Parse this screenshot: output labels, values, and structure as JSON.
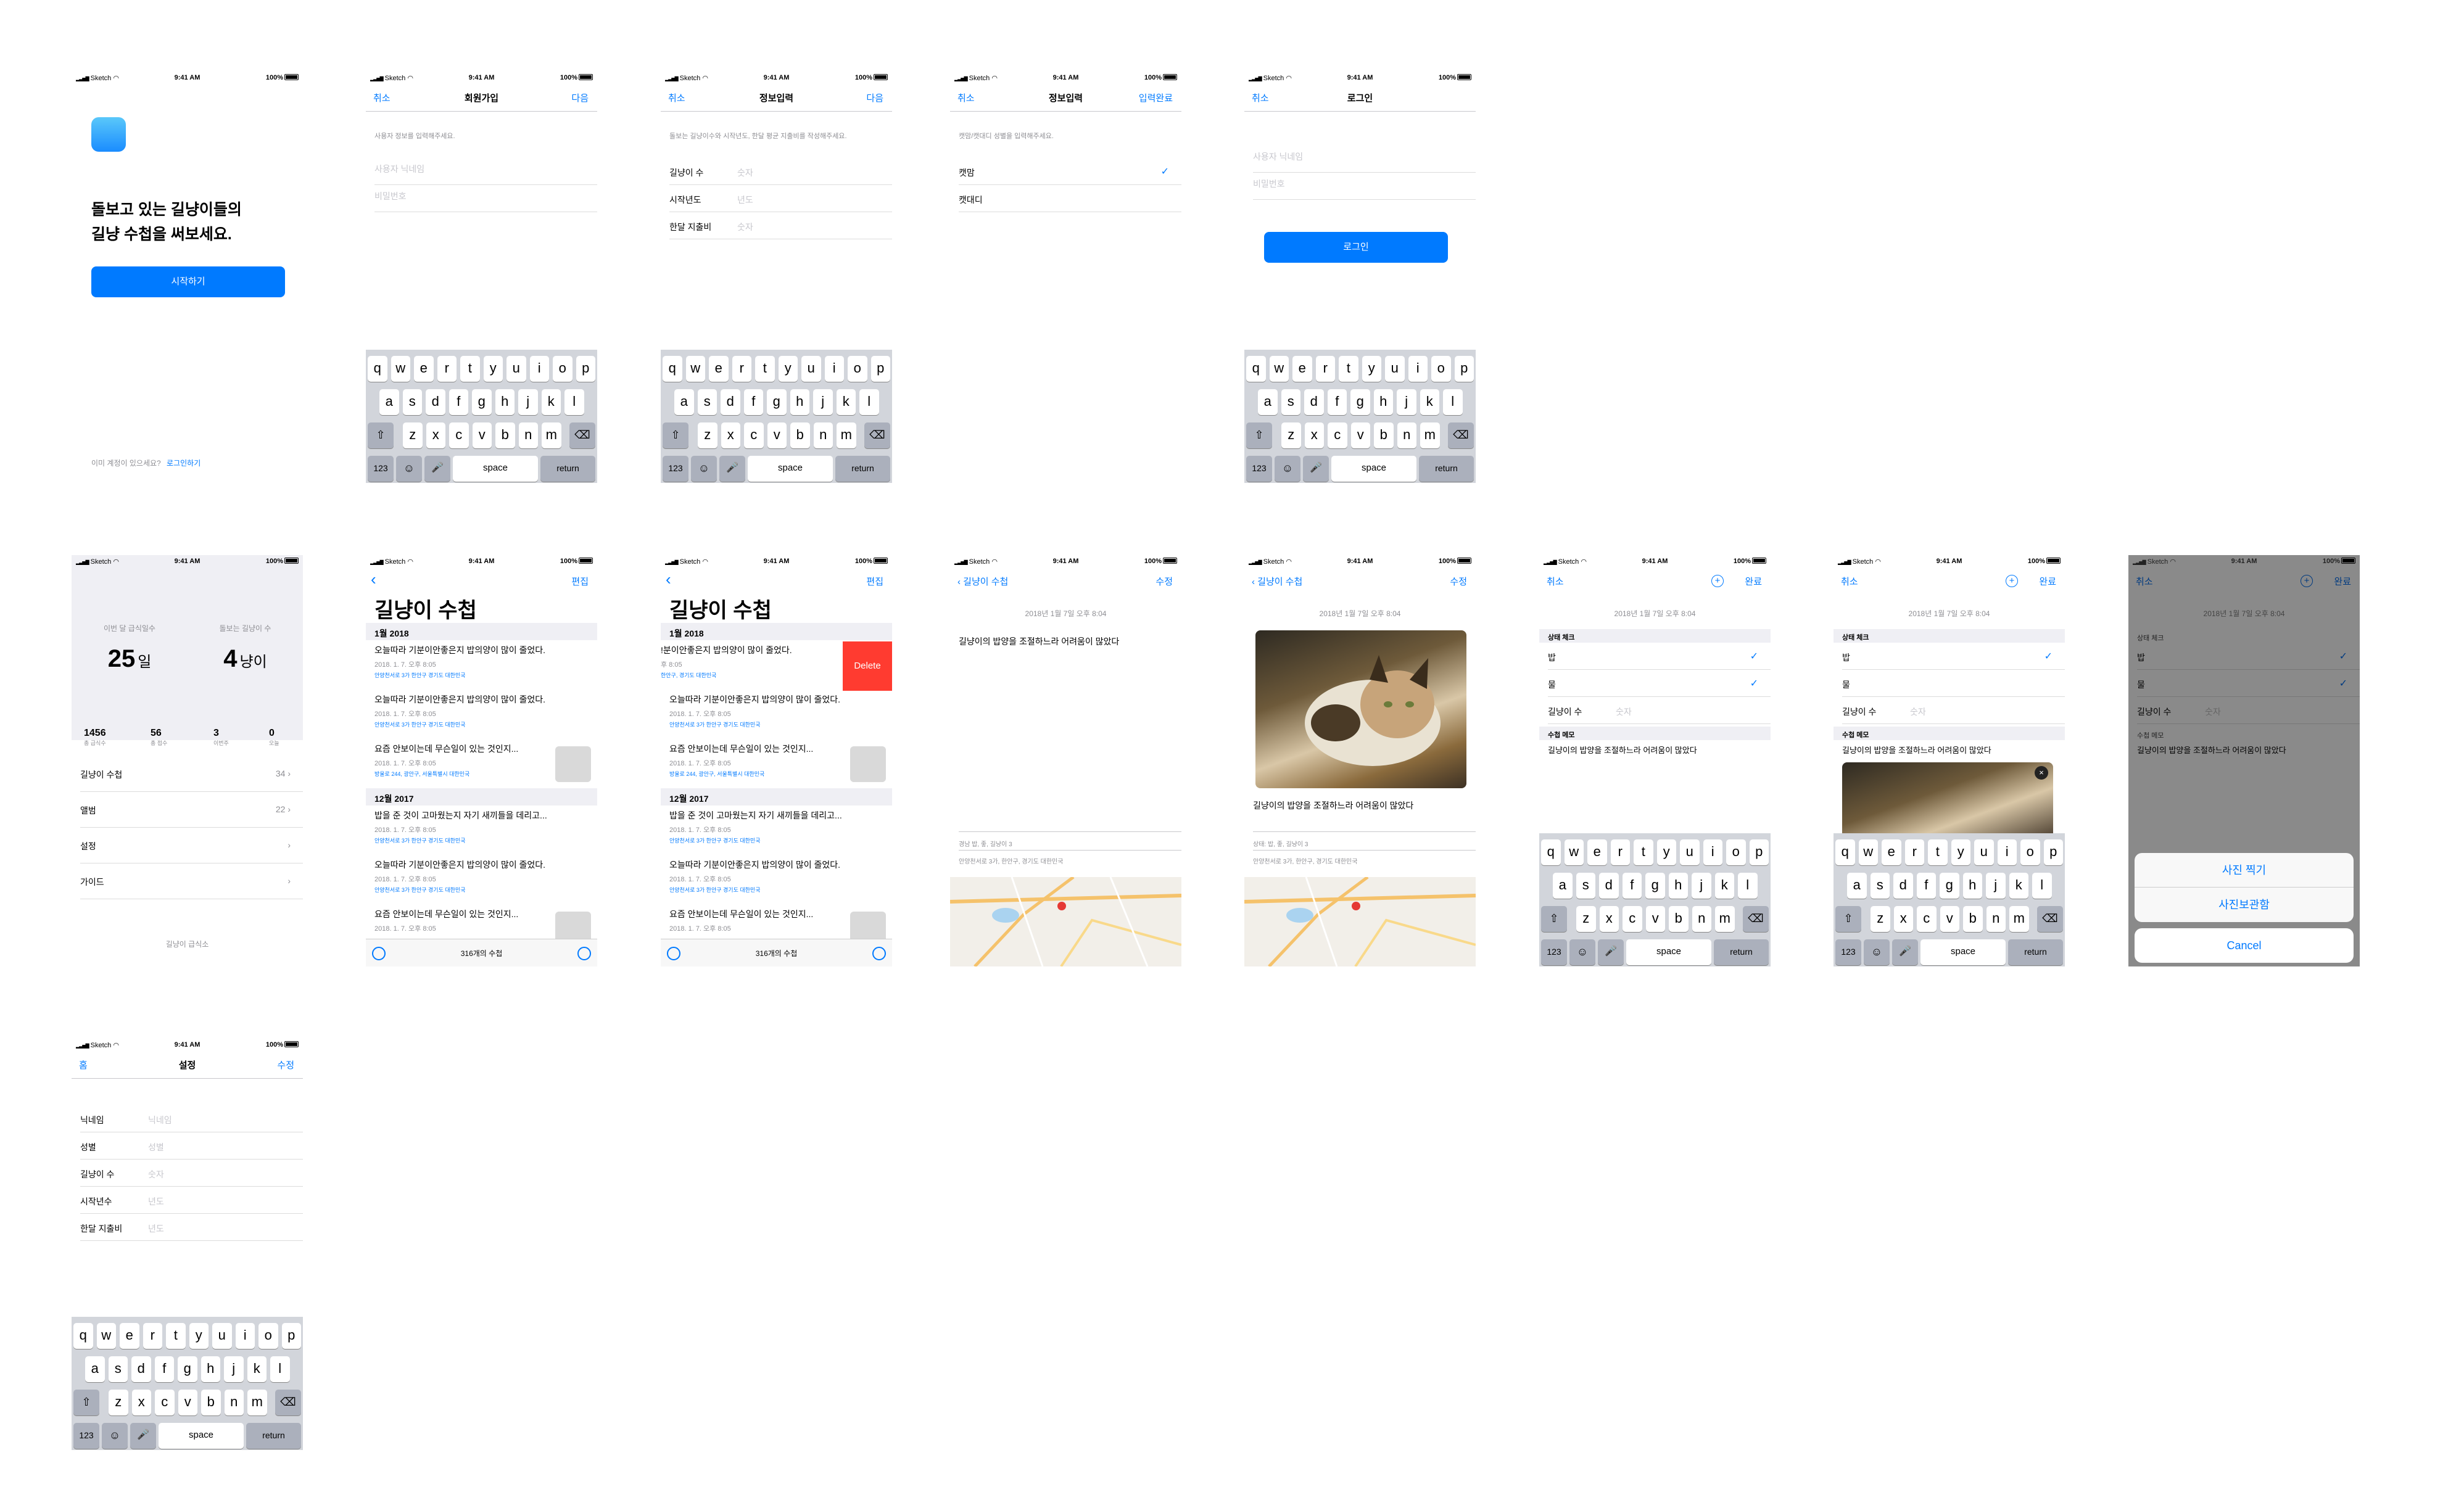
{
  "status": {
    "carrier": "Sketch",
    "time": "9:41 AM",
    "battery": "100%"
  },
  "kb": {
    "row1": [
      "q",
      "w",
      "e",
      "r",
      "t",
      "y",
      "u",
      "i",
      "o",
      "p"
    ],
    "row2": [
      "a",
      "s",
      "d",
      "f",
      "g",
      "h",
      "j",
      "k",
      "l"
    ],
    "row3": [
      "z",
      "x",
      "c",
      "v",
      "b",
      "n",
      "m"
    ],
    "num": "123",
    "space": "space",
    "ret": "return"
  },
  "s1": {
    "headline1": "돌보고 있는 길냥이들의",
    "headline2": "길냥 수첩을 써보세요.",
    "start": "시작하기",
    "account_q": "이미 계정이 있으세요?",
    "login_link": "로그인하기"
  },
  "s2": {
    "cancel": "취소",
    "title": "회원가입",
    "next": "다음",
    "hint": "사용자 정보를 입력해주세요.",
    "nick_ph": "사용자 닉네임",
    "pw_ph": "비밀번호"
  },
  "s3": {
    "cancel": "취소",
    "title": "정보입력",
    "next": "다음",
    "hint": "돌보는 길냥이수와 시작년도, 한달 평균 지출비를 작성해주세요.",
    "f1": "길냥이 수",
    "f1_ph": "숫자",
    "f2": "시작년도",
    "f2_ph": "년도",
    "f3": "한달 지출비",
    "f3_ph": "숫자"
  },
  "s4": {
    "cancel": "취소",
    "title": "정보입력",
    "done": "입력완료",
    "hint": "캣맘/캣대디 성별을 입력해주세요.",
    "o1": "캣맘",
    "o2": "캣대디"
  },
  "s5": {
    "cancel": "취소",
    "title": "로그인",
    "nick_ph": "사용자 닉네임",
    "pw_ph": "비밀번호",
    "login": "로그인"
  },
  "s6": {
    "lbl1": "이번 달 급식일수",
    "lbl2": "돌보는 길냥이 수",
    "v1": "25",
    "u1": "일",
    "v2": "4",
    "u2": "냥이",
    "stats": [
      {
        "n": "1456",
        "l": "총 급식수"
      },
      {
        "n": "56",
        "l": "총 접수"
      },
      {
        "n": "3",
        "l": "이번주"
      },
      {
        "n": "0",
        "l": "오늘"
      }
    ],
    "rows": [
      {
        "label": "길냥이 수첩",
        "val": "34"
      },
      {
        "label": "앨범",
        "val": "22"
      },
      {
        "label": "설정",
        "val": ""
      },
      {
        "label": "가이드",
        "val": ""
      }
    ],
    "footer": "길냥이 급식소"
  },
  "s7": {
    "edit": "편집",
    "title": "길냥이 수첩",
    "sec1": "1월 2018",
    "sec2": "12월 2017",
    "items": [
      {
        "t": "오늘따라 기분이안좋은지 밥의양이 많이 줄었다.",
        "d": "2018. 1. 7. 오후 8:05",
        "a": "안양천서로 3가 한안구 경기도 대한민국"
      },
      {
        "t": "오늘따라 기분이안좋은지 밥의양이 많이 줄었다.",
        "d": "2018. 1. 7. 오후 8:05",
        "a": "안양천서로 3가 한안구 경기도 대한민국"
      },
      {
        "t": "요즘 안보이는데 무슨일이 있는 것인지...",
        "d": "2018. 1. 7. 오후 8:05",
        "a": "방울로 244, 광안구, 서울특별시 대한민국"
      },
      {
        "t": "밥을 준 것이 고마웠는지 자기 새끼들을 데리고...",
        "d": "2018. 1. 7. 오후 8:05",
        "a": "안양천서로 3가 한안구 경기도 대한민국"
      },
      {
        "t": "오늘따라 기분이안좋은지 밥의양이 많이 줄었다.",
        "d": "2018. 1. 7. 오후 8:05",
        "a": "안양천서로 3가 한안구 경기도 대한민국"
      },
      {
        "t": "요즘 안보이는데 무슨일이 있는 것인지...",
        "d": "2018. 1. 7. 오후 8:05",
        "a": "방울로 244, 광안구, 서울특별시 대한민국"
      }
    ],
    "count": "316개의 수첩"
  },
  "s8": {
    "edit": "편집",
    "title": "길냥이 수첩",
    "sec1": "1월 2018",
    "sec2": "12월 2017",
    "first_t": "!분이안좋은지 밥의양이 많이 줄었다.",
    "first_d": "후 8:05",
    "first_a": "한안구, 경기도 대한민국",
    "delete": "Delete",
    "count": "316개의 수첩"
  },
  "s9": {
    "back": "길냥이 수첩",
    "edit": "수정",
    "date": "2018년 1월 7일 오후 8:04",
    "memo": "길냥이의 밥양을 조절하느라 어려움이 많았다",
    "loc1": "경남 밥, 좋, 길냥이 3",
    "loc2": "안양천서로 3가, 한안구, 경기도 대한민국"
  },
  "s10": {
    "back": "길냥이 수첩",
    "edit": "수정",
    "date": "2018년 1월 7일 오후 8:04",
    "memo": "길냥이의 밥양을 조절하느라 어려움이 많았다",
    "loc1": "상태: 밥, 좋, 길냥이 3",
    "loc2": "안양천서로 3가, 한안구, 경기도 대한민국"
  },
  "s11": {
    "cancel": "취소",
    "done": "완료",
    "date": "2018년 1월 7일 오후 8:04",
    "sec": "상태 체크",
    "o1": "밥",
    "o2": "물",
    "f1": "길냥이 수",
    "f1_ph": "숫자",
    "memo_lbl": "수첩 메모",
    "memo": "길냥이의 밥양을 조절하느라 어려움이 많았다"
  },
  "s12": {
    "cancel": "취소",
    "done": "완료",
    "date": "2018년 1월 7일 오후 8:04",
    "sec": "상태 체크",
    "o1": "밥",
    "o2": "물",
    "f1": "길냥이 수",
    "f1_ph": "숫자",
    "memo_lbl": "수첩 메모",
    "memo": "길냥이의 밥양을 조절하느라 어려움이 많았다"
  },
  "s13": {
    "cancel": "취소",
    "done": "완료",
    "date": "2018년 1월 7일 오후 8:04",
    "sec": "상태 체크",
    "o1": "밥",
    "o2": "물",
    "f1": "길냥이 수",
    "f1_ph": "숫자",
    "memo_lbl": "수첩 메모",
    "memo": "길냥이의 밥양을 조절하느라 어려움이 많았다",
    "take": "사진 찍기",
    "library": "사진보관함",
    "cancel_btn": "Cancel"
  },
  "s14": {
    "home": "홈",
    "title": "설정",
    "edit": "수정",
    "f": [
      {
        "l": "닉네임",
        "p": "닉네임"
      },
      {
        "l": "성별",
        "p": "성별"
      },
      {
        "l": "길냥이 수",
        "p": "숫자"
      },
      {
        "l": "시작년수",
        "p": "년도"
      },
      {
        "l": "한달 지출비",
        "p": "년도"
      }
    ]
  },
  "colors": {
    "accent": "#007aff",
    "delete": "#ff3b30"
  }
}
